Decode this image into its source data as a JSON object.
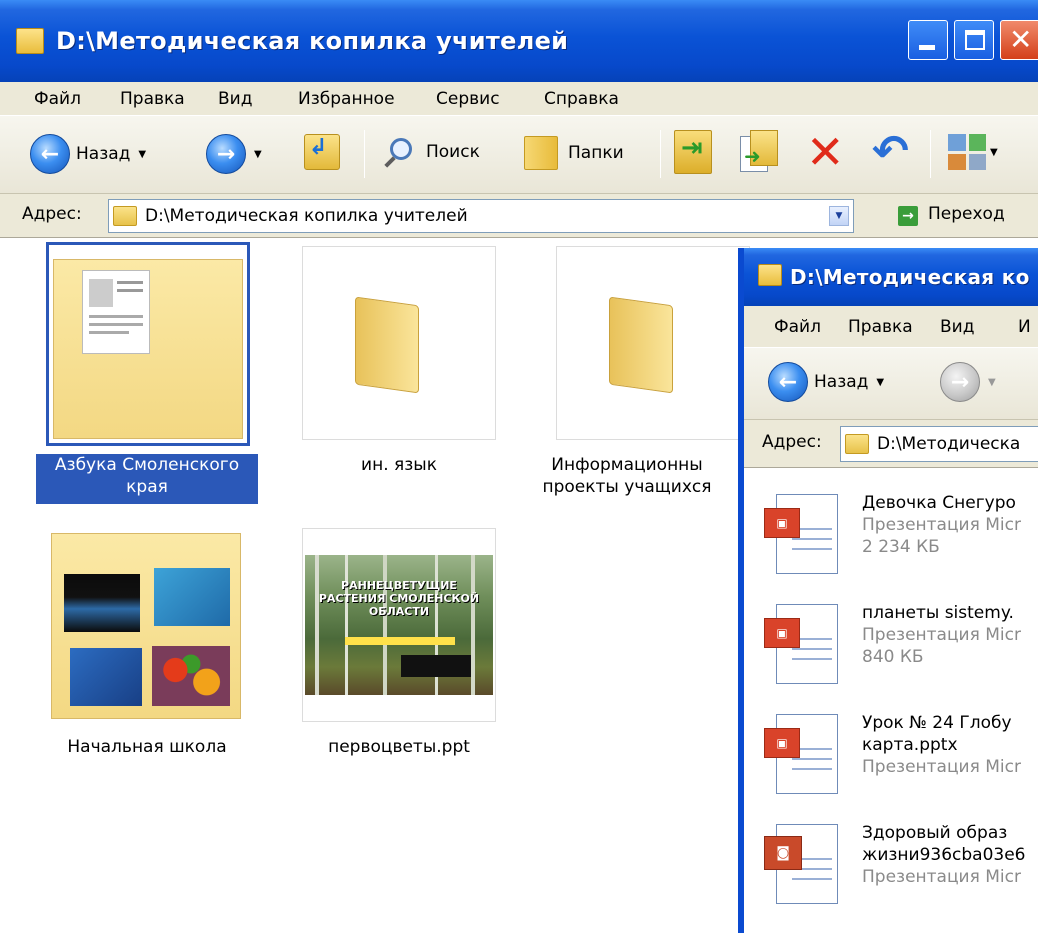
{
  "main_window": {
    "title": "D:\\Методическая копилка учителей",
    "menu": [
      "Файл",
      "Правка",
      "Вид",
      "Избранное",
      "Сервис",
      "Справка"
    ],
    "toolbar": {
      "back_label": "Назад",
      "search_label": "Поиск",
      "folders_label": "Папки"
    },
    "address": {
      "label": "Адрес:",
      "value": "D:\\Методическая копилка учителей",
      "go_label": "Переход"
    },
    "items": [
      {
        "label_line1": "Азбука Смоленского",
        "label_line2": "края",
        "selected": true
      },
      {
        "label_line1": "ин. язык",
        "label_line2": ""
      },
      {
        "label_line1": "Информационны",
        "label_line2": "проекты учащихся"
      },
      {
        "label_line1": "Начальная школа",
        "label_line2": ""
      },
      {
        "label_line1": "первоцветы.ppt",
        "label_line2": ""
      }
    ],
    "slide_text": "РАННЕЦВЕТУЩИЕ РАСТЕНИЯ СМОЛЕНСКОЙ ОБЛАСТИ"
  },
  "second_window": {
    "title": "D:\\Методическая ко",
    "menu": [
      "Файл",
      "Правка",
      "Вид",
      "И"
    ],
    "toolbar": {
      "back_label": "Назад"
    },
    "address": {
      "label": "Адрес:",
      "value": "D:\\Методическа"
    },
    "files": [
      {
        "name1": "Девочка Снегуро",
        "name2": "",
        "sub1": "Презентация Micr",
        "sub2": "2 234 КБ",
        "kind": "ppt"
      },
      {
        "name1": "планеты sistemy.",
        "name2": "",
        "sub1": "Презентация Micr",
        "sub2": "840 КБ",
        "kind": "ppt"
      },
      {
        "name1": "Урок № 24 Глобу",
        "name2": "карта.pptx",
        "sub1": "Презентация Micr",
        "sub2": "",
        "kind": "ppt"
      },
      {
        "name1": "Здоровый образ",
        "name2": "жизни936cba03e6",
        "sub1": "Презентация Micr",
        "sub2": "",
        "kind": "pps"
      }
    ]
  },
  "colors": {
    "title_blue": "#0a53d6",
    "selection": "#2b58b8",
    "menu_bg": "#ece9d8"
  }
}
